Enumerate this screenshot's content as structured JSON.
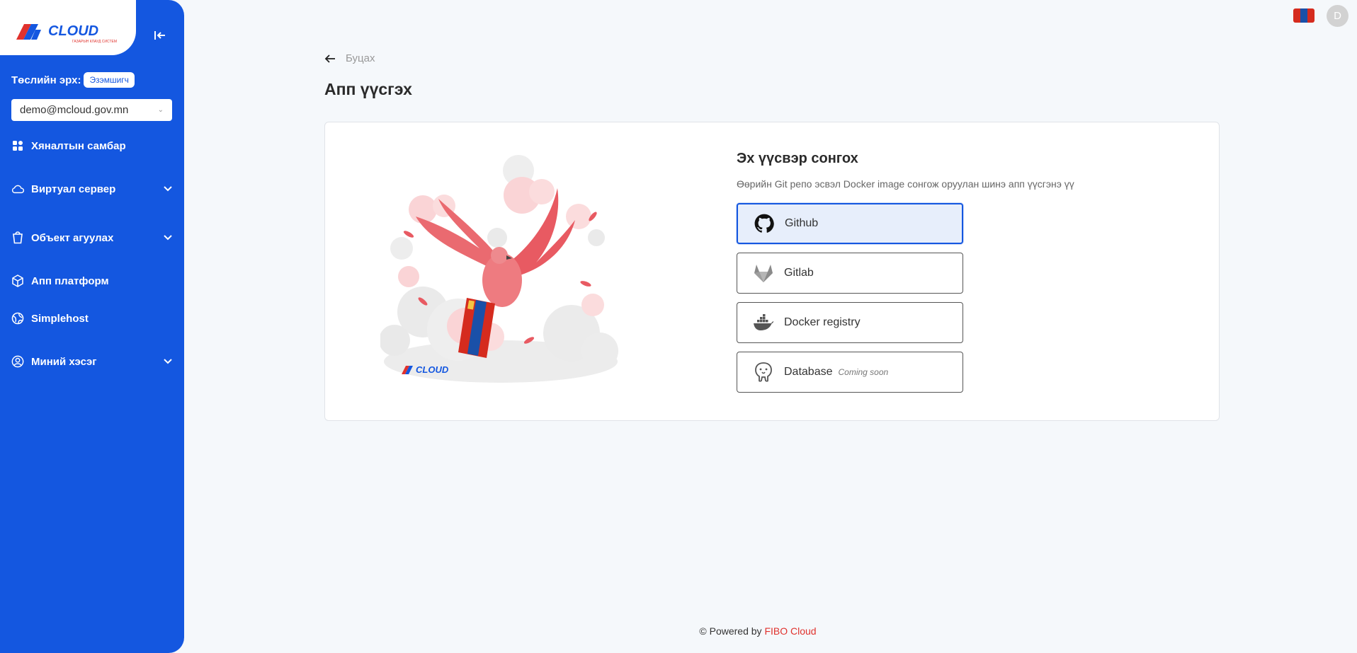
{
  "sidebar": {
    "logo_text": "CLOUD",
    "logo_tagline": "ГАЗАРЫН КЛАУД СИСТЕМ",
    "role_label": "Төслийн эрх:",
    "role_badge": "Эзэмшигч",
    "account": "demo@mcloud.gov.mn",
    "items": [
      {
        "label": "Хяналтын самбар",
        "icon": "dashboard-icon",
        "expandable": false
      },
      {
        "label": "Виртуал сервер",
        "icon": "cloud-icon",
        "expandable": true
      },
      {
        "label": "Объект агуулах",
        "icon": "bucket-icon",
        "expandable": true
      },
      {
        "label": "Апп платформ",
        "icon": "box-icon",
        "expandable": false
      },
      {
        "label": "Simplehost",
        "icon": "globe-icon",
        "expandable": false
      },
      {
        "label": "Миний хэсэг",
        "icon": "user-icon",
        "expandable": true
      }
    ]
  },
  "topbar": {
    "avatar_initial": "D",
    "flag_colors": [
      "#d52b1e",
      "#1a50a8",
      "#d52b1e"
    ]
  },
  "header": {
    "back_label": "Буцах",
    "title": "Апп үүсгэх"
  },
  "source": {
    "title": "Эх үүсвэр сонгох",
    "subtitle": "Өөрийн Git репо эсвэл Docker image сонгож оруулан шинэ апп үүсгэнэ үү",
    "options": [
      {
        "label": "Github",
        "icon": "github-icon",
        "selected": true,
        "note": ""
      },
      {
        "label": "Gitlab",
        "icon": "gitlab-icon",
        "selected": false,
        "note": ""
      },
      {
        "label": "Docker registry",
        "icon": "docker-icon",
        "selected": false,
        "note": ""
      },
      {
        "label": "Database",
        "icon": "postgres-icon",
        "selected": false,
        "note": "Coming soon"
      }
    ]
  },
  "illustration": {
    "logo_text": "CLOUD"
  },
  "footer": {
    "prefix": "© Powered by",
    "brand": "FIBO Cloud"
  },
  "colors": {
    "primary": "#1457e0",
    "accent": "#e0322d",
    "bird": "#ea6a70"
  }
}
